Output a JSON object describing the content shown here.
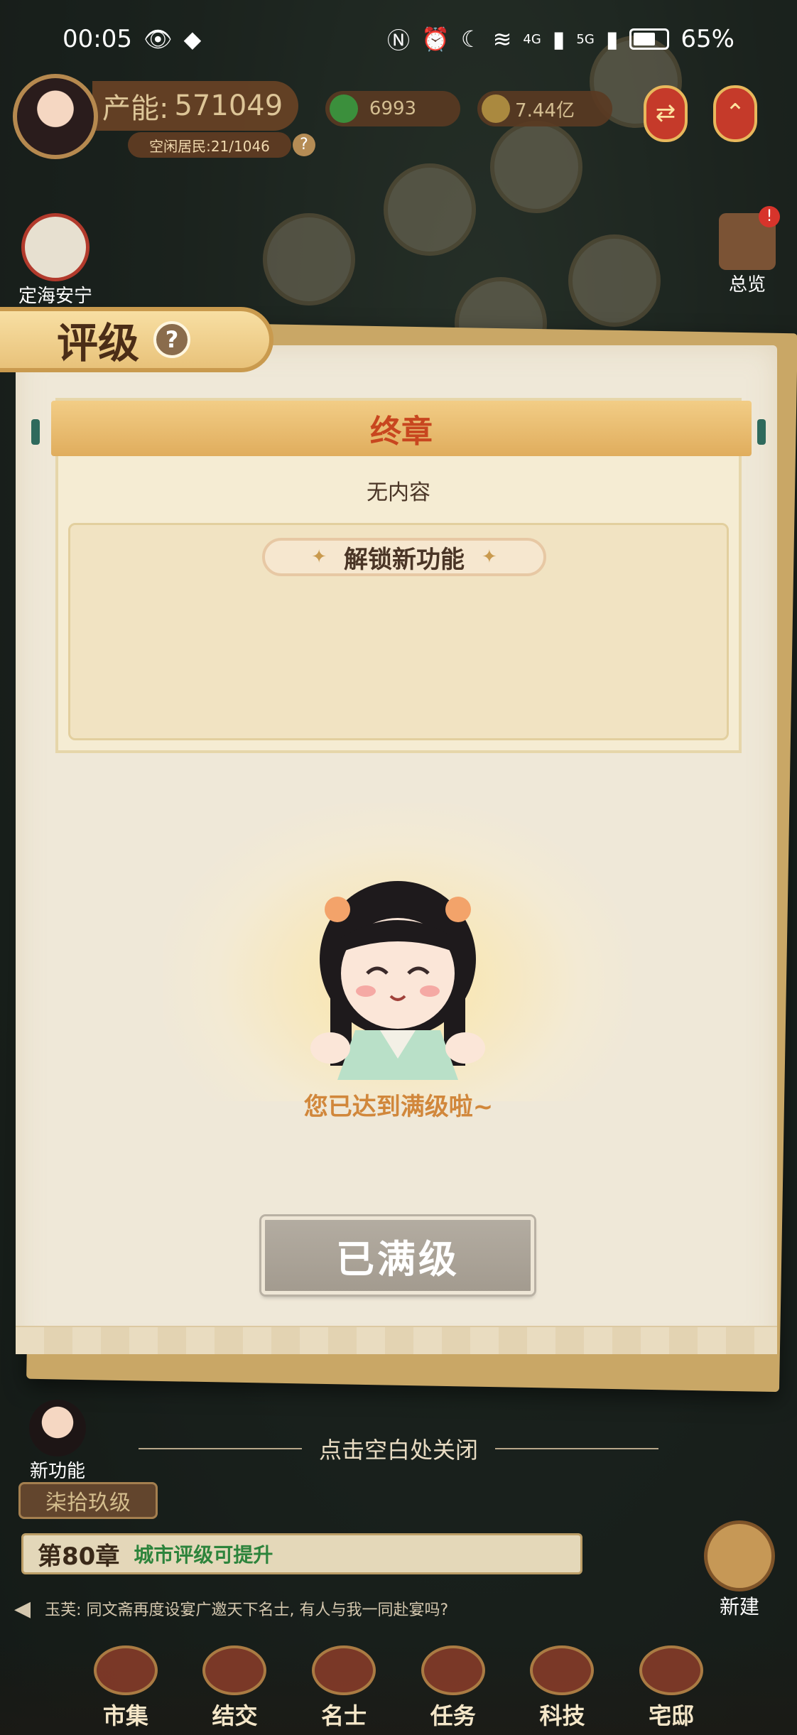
{
  "status_bar": {
    "time": "00:05",
    "battery": "65%",
    "network_1": "4G",
    "network_2": "5G"
  },
  "hud": {
    "production_label": "产能:",
    "production_value": "571049",
    "idle_residents": "空闲居民:21/1046",
    "jade": "6993",
    "copper": "7.44亿",
    "left_event": "定海安宁",
    "overview": "总览",
    "overview_badge": "!"
  },
  "modal": {
    "title": "评级",
    "help": "?",
    "chapter_title": "终章",
    "no_content": "无内容",
    "unlock_heading": "解锁新功能",
    "maxed_message": "您已达到满级啦~",
    "maxed_button": "已满级"
  },
  "close_hint": "点击空白处关闭",
  "bottom": {
    "new_feature": "新功能",
    "level": "柒拾玖级",
    "chapter": "第80章",
    "chapter_tip": "城市评级可提升",
    "chat": "玉芙: 同文斋再度设宴广邀天下名士, 有人与我一同赴宴吗?",
    "new_build": "新建",
    "nav": [
      "市集",
      "结交",
      "名士",
      "任务",
      "科技",
      "宅邸"
    ]
  },
  "colors": {
    "accent_gold": "#e0ad5d",
    "chapter_red": "#c8461f",
    "maxed_orange": "#d1873b",
    "tip_green": "#2f8a3e"
  }
}
